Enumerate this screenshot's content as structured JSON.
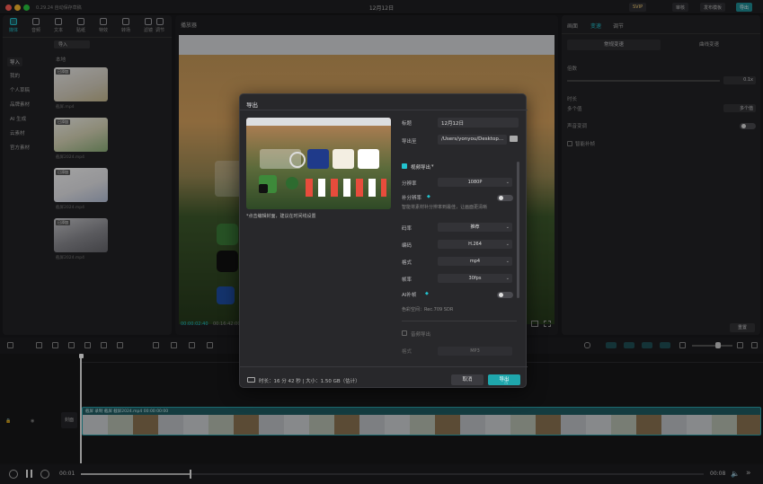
{
  "titlebar": {
    "left_text": "0.29.24 自动保存草稿",
    "title": "12月12日",
    "badge": "SVIP",
    "btn_share": "审核",
    "btn_publish": "发布模板",
    "btn_export": "导出"
  },
  "toolbar_tabs": [
    "媒体",
    "音频",
    "文本",
    "贴纸",
    "特效",
    "转场",
    "滤镜",
    "调节"
  ],
  "left": {
    "filter_label": "导入",
    "subheader": "本地",
    "categories": [
      "导入",
      "我的",
      "个人草稿",
      "品牌素材",
      "AI 生成",
      "云素材",
      "官方素材"
    ],
    "media": [
      {
        "badge": "已添加",
        "caption": "截屏.mp4"
      },
      {
        "badge": "已添加",
        "caption": "截屏2024.mp4"
      },
      {
        "badge": "已添加",
        "caption": "截屏2024.mp4"
      },
      {
        "badge": "已添加",
        "caption": "截屏2024.mp4"
      }
    ]
  },
  "player": {
    "title": "播放器",
    "time_current": "00:00:02:40",
    "time_total": "00:16:42:00"
  },
  "right": {
    "tabs": [
      "画面",
      "变速",
      "调节"
    ],
    "subtabs": [
      "常规变速",
      "曲线变速"
    ],
    "speed_label": "倍数",
    "speed_value": "0.1x",
    "duration_label": "时长",
    "duration_a": "多个值",
    "duration_b": "多个值",
    "audio_label": "声音变调",
    "smart_label": "智能补帧",
    "reset": "重置"
  },
  "dialog": {
    "title": "导出",
    "cover_hint": "*点击编辑封面，建议在时间线设置",
    "name_label": "标题",
    "name_value": "12月12日",
    "path_label": "导出至",
    "path_value": "/Users/yonyou/Desktop...",
    "video_section": "视频导出",
    "rows": [
      {
        "label": "分辨率",
        "value": "1080P"
      },
      {
        "label": "码率",
        "value": "推荐"
      },
      {
        "label": "编码",
        "value": "H.264"
      },
      {
        "label": "格式",
        "value": "mp4"
      },
      {
        "label": "帧率",
        "value": "30fps"
      }
    ],
    "hdr_label": "补分辨率",
    "hdr_desc": "智能将素材补分辨率到最佳，让画面更清晰",
    "ai_label": "AI补帧",
    "color_label": "色彩空间：Rec.709 SDR",
    "audio_section": "音频导出",
    "audio_format_label": "格式",
    "audio_format_value": "MP3",
    "footer_info": "时长：16 分 42 秒 | 大小：1.50 GB（估计）",
    "cancel": "取消",
    "export": "导出"
  },
  "timeline": {
    "track_label": "封面",
    "clip_label": "截屏 录制 截屏 截屏2024.mp4 00:00:00:00",
    "time_left": "00:01",
    "time_right": "00:08"
  },
  "colors": {
    "accent": "#22c3cf",
    "export_btn": "#1fa7ad",
    "bg": "#1a1a1d",
    "panel": "#232326",
    "clip": "#1f5c63"
  }
}
